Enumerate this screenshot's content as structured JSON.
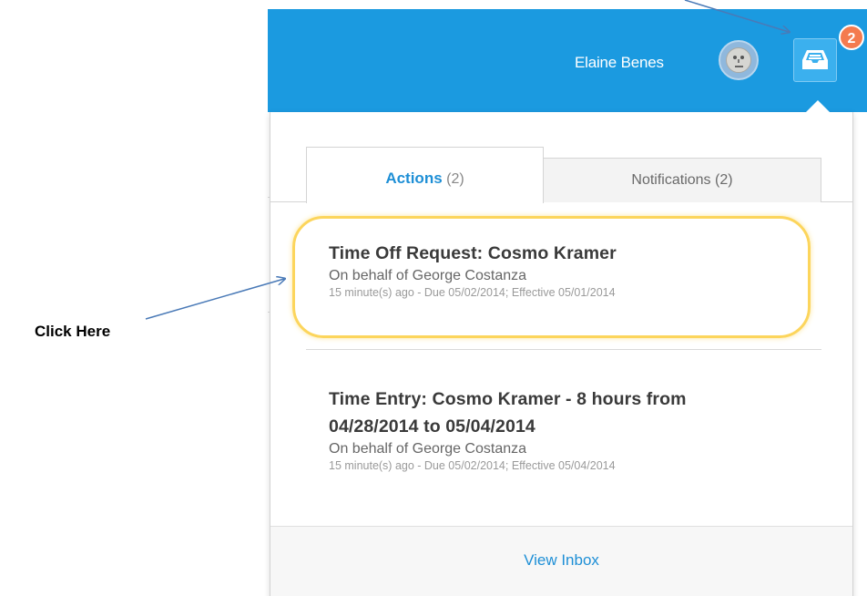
{
  "header": {
    "user_name": "Elaine Benes",
    "badge_count": "2",
    "background_color": "#1b9ae0"
  },
  "tabs": [
    {
      "label": "Actions",
      "count": "(2)",
      "active": true
    },
    {
      "label": "Notifications",
      "count": "(2)",
      "active": false
    }
  ],
  "items": [
    {
      "title": "Time Off Request: Cosmo Kramer",
      "subtitle": "On behalf of George Costanza",
      "meta": "15 minute(s) ago - Due 05/02/2014; Effective 05/01/2014",
      "highlighted": true
    },
    {
      "title": "Time Entry: Cosmo Kramer - 8 hours from 04/28/2014 to 05/04/2014",
      "subtitle": "On behalf of George Costanza",
      "meta": "15 minute(s) ago - Due 05/02/2014; Effective 05/04/2014",
      "highlighted": false
    }
  ],
  "footer": {
    "view_inbox_label": "View Inbox"
  },
  "annotation": {
    "label": "Click Here",
    "arrow_color": "#4a7ab7",
    "highlight_color": "#fcd55c"
  },
  "icons": {
    "inbox": "inbox-tray-icon",
    "avatar": "user-avatar"
  }
}
